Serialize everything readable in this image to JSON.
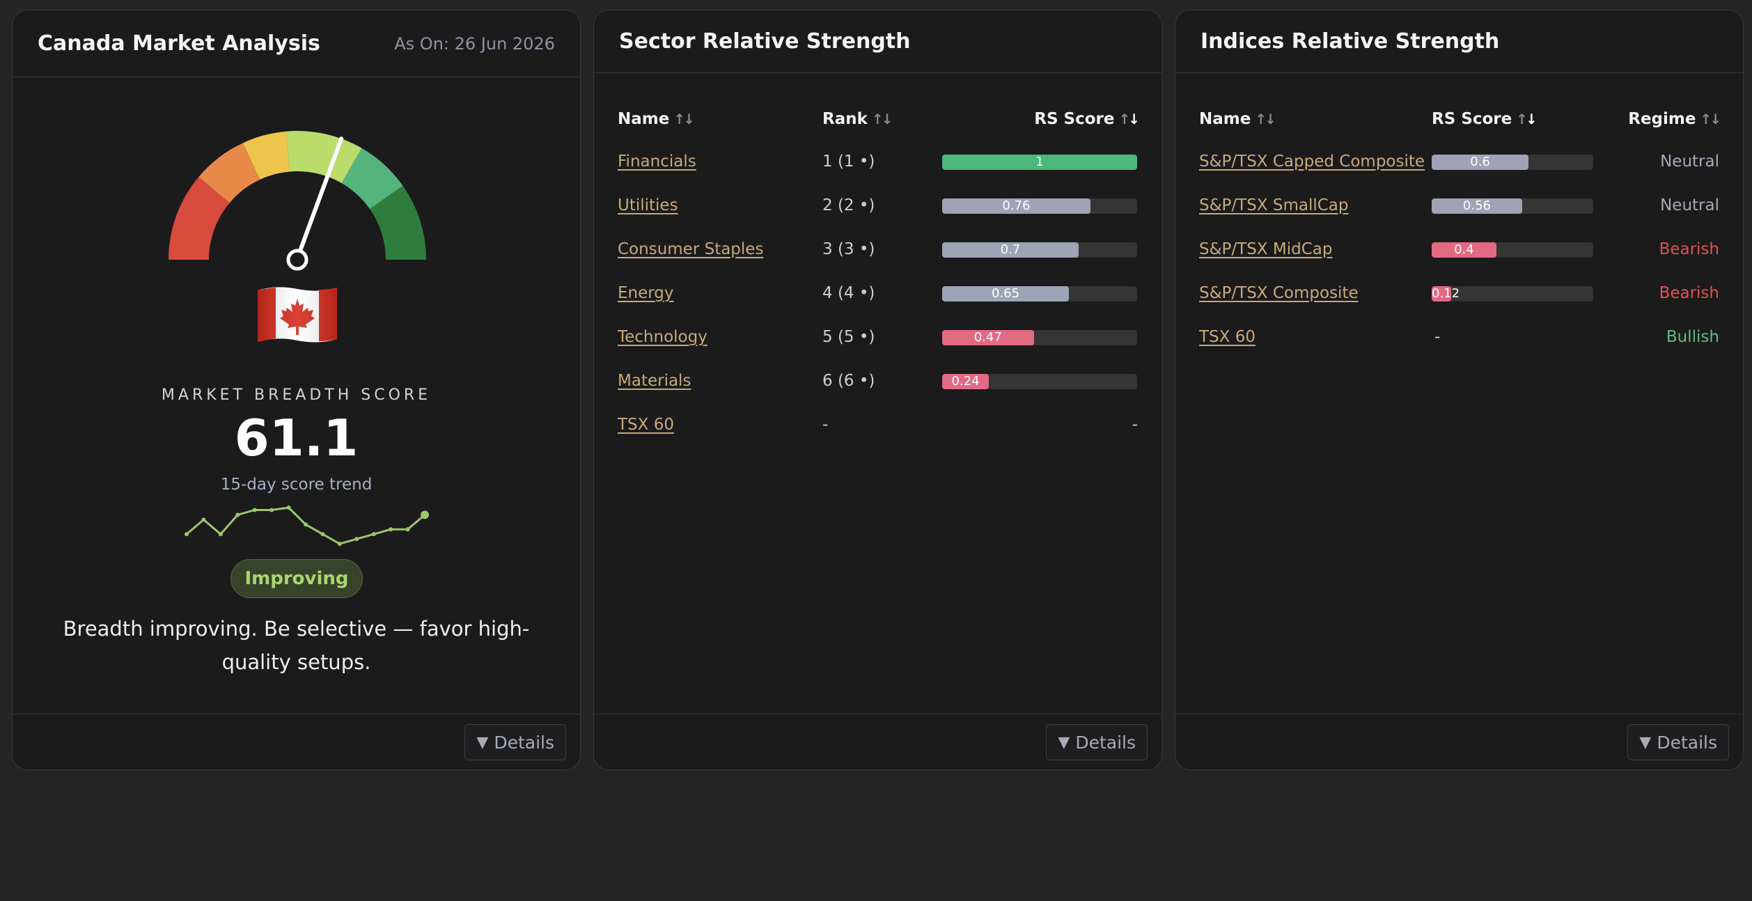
{
  "market": {
    "title": "Canada Market Analysis",
    "as_on": "As On: 26 Jun 2026",
    "flag_icon": "canada-flag-icon",
    "breadth_label": "MARKET BREADTH SCORE",
    "breadth_score": "61.1",
    "breadth_score_value": 61.1,
    "trend_label": "15-day score trend",
    "trend_values": [
      57,
      60,
      57,
      61,
      62,
      62,
      62.5,
      59,
      57,
      55,
      56,
      57,
      58,
      58,
      61
    ],
    "status": "Improving",
    "advice": "Breadth improving. Be selective — favor high-quality setups.",
    "details": "Details"
  },
  "sectors": {
    "title": "Sector Relative Strength",
    "headers": {
      "name": "Name",
      "rank": "Rank",
      "rs": "RS Score"
    },
    "rows": [
      {
        "name": "Financials",
        "rank": "1 (1 •)",
        "rs": 1,
        "rs_label": "1",
        "color": "#4db87c"
      },
      {
        "name": "Utilities",
        "rank": "2 (2 •)",
        "rs": 0.76,
        "rs_label": "0.76",
        "color": "#9ea3b5"
      },
      {
        "name": "Consumer Staples",
        "rank": "3 (3 •)",
        "rs": 0.7,
        "rs_label": "0.7",
        "color": "#9ea3b5"
      },
      {
        "name": "Energy",
        "rank": "4 (4 •)",
        "rs": 0.65,
        "rs_label": "0.65",
        "color": "#9ea3b5"
      },
      {
        "name": "Technology",
        "rank": "5 (5 •)",
        "rs": 0.47,
        "rs_label": "0.47",
        "color": "#e36a83"
      },
      {
        "name": "Materials",
        "rank": "6 (6 •)",
        "rs": 0.24,
        "rs_label": "0.24",
        "color": "#e36a83"
      },
      {
        "name": "TSX 60",
        "rank": "-",
        "rs": null,
        "rs_label": "-",
        "color": ""
      }
    ],
    "details": "Details"
  },
  "indices": {
    "title": "Indices Relative Strength",
    "headers": {
      "name": "Name",
      "rs": "RS Score",
      "regime": "Regime"
    },
    "rows": [
      {
        "name": "S&P/TSX Capped Composite",
        "rs": 0.6,
        "rs_label": "0.6",
        "color": "#9ea3b5",
        "regime": "Neutral",
        "regime_color": "#a5aabb"
      },
      {
        "name": "S&P/TSX SmallCap",
        "rs": 0.56,
        "rs_label": "0.56",
        "color": "#9ea3b5",
        "regime": "Neutral",
        "regime_color": "#a5aabb"
      },
      {
        "name": "S&P/TSX MidCap",
        "rs": 0.4,
        "rs_label": "0.4",
        "color": "#e36a83",
        "regime": "Bearish",
        "regime_color": "#e0524f"
      },
      {
        "name": "S&P/TSX Composite",
        "rs": 0.12,
        "rs_label": "0.12",
        "color": "#e36a83",
        "regime": "Bearish",
        "regime_color": "#e0524f"
      },
      {
        "name": "TSX 60",
        "rs": null,
        "rs_label": "-",
        "color": "",
        "regime": "Bullish",
        "regime_color": "#5cc07d"
      }
    ],
    "details": "Details"
  }
}
